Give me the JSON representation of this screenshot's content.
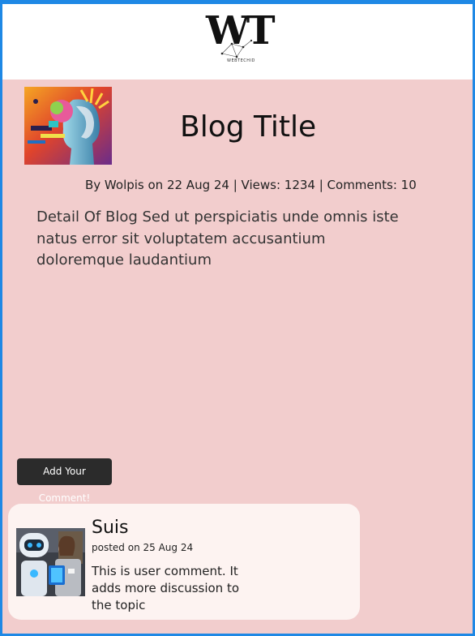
{
  "header": {
    "logo_letters": "WT",
    "logo_subtext": "WEBTECHID"
  },
  "post": {
    "title": "Blog Title",
    "meta": "By Wolpis on 22 Aug 24 | Views: 1234 | Comments: 10",
    "body": "Detail Of Blog Sed ut perspiciatis unde omnis iste natus error sit voluptatem accusantium doloremque laudantium",
    "image_icon": "ai-head-illustration"
  },
  "actions": {
    "add_comment_label": "Add Your Comment!"
  },
  "comments": [
    {
      "author": "Suis",
      "date": "posted on 25 Aug 24",
      "text": "This is user comment. It adds more discussion to the topic",
      "avatar_icon": "robot-and-woman-photo"
    }
  ],
  "colors": {
    "page_bg": "#f2cdcd",
    "header_bg": "#ffffff",
    "frame": "#1e88e5",
    "button_bg": "#2b2b2b",
    "card_bg": "#fdf3f1"
  }
}
